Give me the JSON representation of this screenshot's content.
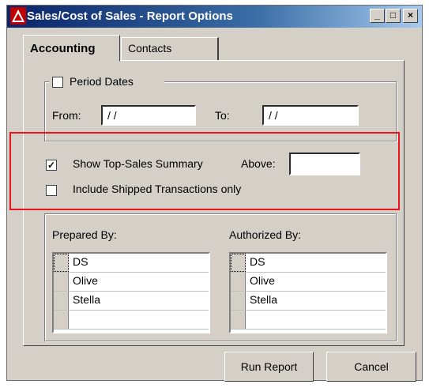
{
  "window": {
    "title": "Sales/Cost of Sales - Report Options",
    "controls": {
      "minimize": "_",
      "maximize": "□",
      "close": "×"
    }
  },
  "tabs": [
    {
      "label": "Accounting",
      "active": true
    },
    {
      "label": "Contacts",
      "active": false
    }
  ],
  "period": {
    "checkbox_label": "Period Dates",
    "checked": false,
    "from_label": "From:",
    "from_value": " / /",
    "to_label": "To:",
    "to_value": " / /"
  },
  "summary": {
    "show_top_sales_label": "Show Top-Sales Summary",
    "show_top_sales_checked": true,
    "above_label": "Above:",
    "above_value": "",
    "include_shipped_label": "Include Shipped Transactions only",
    "include_shipped_checked": false
  },
  "prepared_by": {
    "label": "Prepared By:",
    "items": [
      "DS",
      "Olive",
      "Stella",
      ""
    ]
  },
  "authorized_by": {
    "label": "Authorized By:",
    "items": [
      "DS",
      "Olive",
      "Stella",
      ""
    ]
  },
  "buttons": {
    "run_report": "Run Report",
    "cancel": "Cancel"
  },
  "colors": {
    "title_start": "#0a246a",
    "title_end": "#a6caf0",
    "highlight": "#e8141c",
    "face": "#d4d0c8"
  }
}
